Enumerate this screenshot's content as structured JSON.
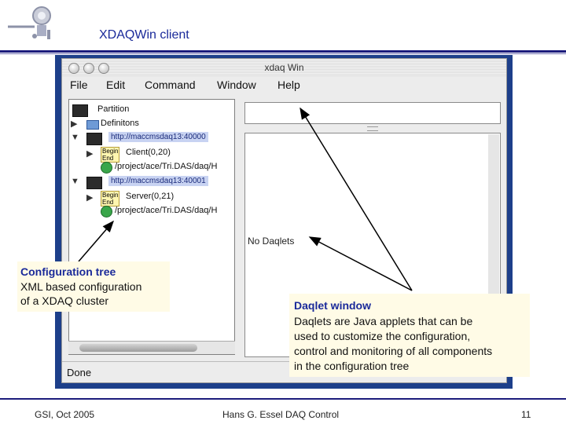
{
  "slide": {
    "title": "XDAQWin client",
    "footer_left": "GSI, Oct 2005",
    "footer_center": "Hans G. Essel  DAQ Control",
    "footer_page": "11"
  },
  "window": {
    "title": "xdaq Win",
    "menu": [
      "File",
      "Edit",
      "Command",
      "Window",
      "Help"
    ],
    "status": "Done",
    "daqlet_placeholder": "No Daqlets"
  },
  "tree": {
    "partition": "Partition",
    "definitions": "Definitons",
    "host1_url": "http://maccmsdaq13:40000",
    "host1_begin": "Begin",
    "host1_end": "End",
    "host1_app": "Client(0,20)",
    "host1_path": "/project/ace/Tri.DAS/daq/H",
    "host2_url": "http://maccmsdaq13:40001",
    "host2_begin": "Begin",
    "host2_end": "End",
    "host2_app": "Server(0,21)",
    "host2_path": "/project/ace/Tri.DAS/daq/H"
  },
  "callouts": {
    "config_head": "Configuration tree",
    "config_line1": "XML based configuration",
    "config_line2": "of a XDAQ cluster",
    "daqlet_head": "Daqlet window",
    "daqlet_line1": "Daqlets are Java applets that can be",
    "daqlet_line2": "used to customize the configuration,",
    "daqlet_line3": "control and monitoring of all components",
    "daqlet_line4": "in the configuration tree"
  },
  "colors": {
    "heading_blue": "#1a2a9a",
    "frame_blue": "#1d3f8a",
    "callout_bg": "#fffbe6"
  }
}
